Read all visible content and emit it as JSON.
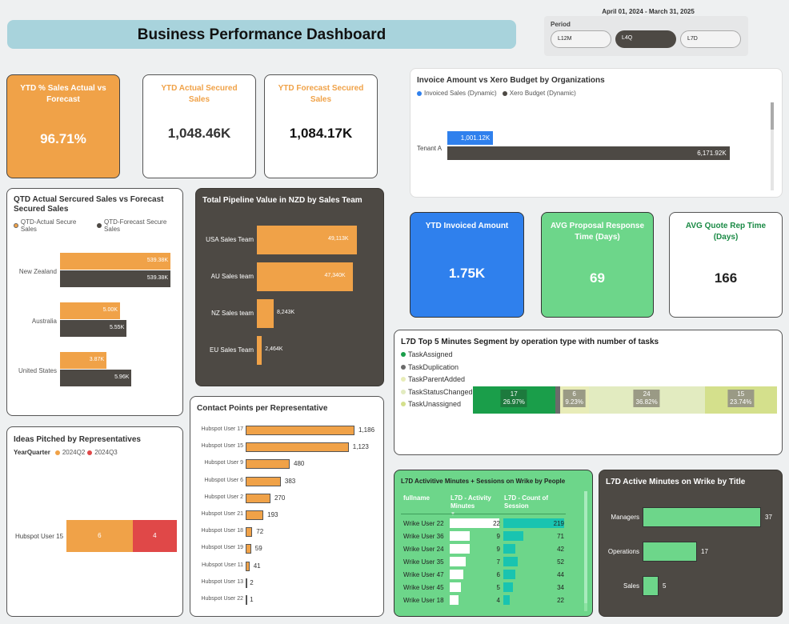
{
  "header": {
    "title": "Business Performance Dashboard",
    "date_range": "April 01, 2024 - March 31, 2025",
    "period_label": "Period",
    "period_options": [
      "L12M",
      "L4Q",
      "L7D"
    ],
    "selected_period": "L4Q"
  },
  "kpis": {
    "ytd_pct": {
      "title": "YTD % Sales Actual vs Forecast",
      "value": "96.71%"
    },
    "ytd_actual": {
      "title": "YTD Actual Secured Sales",
      "value": "1,048.46K"
    },
    "ytd_forecast": {
      "title": "YTD Forecast Secured Sales",
      "value": "1,084.17K"
    },
    "ytd_invoiced": {
      "title": "YTD Invoiced Amount",
      "value": "1.75K"
    },
    "avg_proposal": {
      "title": "AVG Proposal Response Time (Days)",
      "value": "69"
    },
    "avg_quote": {
      "title": "AVG Quote Rep Time (Days)",
      "value": "166"
    }
  },
  "colors": {
    "orange": "#f0a248",
    "dark": "#4d4944",
    "blue": "#2f80ed",
    "green": "#6dd68a",
    "red": "#e04848",
    "teal": "#19c4b0"
  },
  "chart_data": [
    {
      "id": "invoice",
      "type": "bar",
      "title": "Invoice Amount vs Xero Budget by Organizations",
      "categories": [
        "Tenant A"
      ],
      "series": [
        {
          "name": "Invoiced Sales (Dynamic)",
          "values": [
            1001.12
          ],
          "labels": [
            "1,001.12K"
          ]
        },
        {
          "name": "Xero Budget (Dynamic)",
          "values": [
            6171.92
          ],
          "labels": [
            "6,171.92K"
          ]
        }
      ]
    },
    {
      "id": "qtd",
      "type": "bar",
      "title": "QTD Actual Sercured Sales vs Forecast Secured Sales",
      "categories": [
        "New Zealand",
        "Australia",
        "United States"
      ],
      "series": [
        {
          "name": "QTD-Actual Secure Sales",
          "values": [
            539.38,
            5.0,
            3.87
          ],
          "labels": [
            "539.38K",
            "5.00K",
            "3.87K"
          ]
        },
        {
          "name": "QTD-Forecast Secure Sales",
          "values": [
            539.38,
            5.55,
            5.96
          ],
          "labels": [
            "539.38K",
            "5.55K",
            "5.96K"
          ]
        }
      ]
    },
    {
      "id": "pipeline",
      "type": "bar",
      "title": "Total Pipeline Value in NZD by Sales Team",
      "categories": [
        "USA Sales Team",
        "AU Sales team",
        "NZ Sales team",
        "EU Sales Team"
      ],
      "values": [
        49113,
        47340,
        8243,
        2464
      ],
      "labels": [
        "49,113K",
        "47,340K",
        "8,243K",
        "2,464K"
      ]
    },
    {
      "id": "contact",
      "type": "bar",
      "title": "Contact Points per Representative",
      "categories": [
        "Hubspot User 17",
        "Hubspot User 15",
        "Hubspot User 9",
        "Hubspot User 6",
        "Hubspot User 2",
        "Hubspot User 21",
        "Hubspot User 18",
        "Hubspot User 19",
        "Hubspot User 11",
        "Hubspot User 13",
        "Hubspot User 22"
      ],
      "values": [
        1186,
        1123,
        480,
        383,
        270,
        193,
        72,
        59,
        41,
        2,
        1
      ],
      "labels": [
        "1,186",
        "1,123",
        "480",
        "383",
        "270",
        "193",
        "72",
        "59",
        "41",
        "2",
        "1"
      ]
    },
    {
      "id": "ideas",
      "type": "bar",
      "title": "Ideas Pitched by Representatives",
      "legend_title": "YearQuarter",
      "categories": [
        "Hubspot User 15"
      ],
      "series": [
        {
          "name": "2024Q2",
          "values": [
            6
          ]
        },
        {
          "name": "2024Q3",
          "values": [
            4
          ]
        }
      ]
    },
    {
      "id": "segment",
      "type": "bar",
      "title": "L7D Top 5 Minutes Segment by operation type with number of tasks",
      "categories": [
        "TaskAssigned",
        "TaskDuplication",
        "TaskParentAdded",
        "TaskStatusChanged",
        "TaskUnassigned"
      ],
      "colors": [
        "#1a9e4a",
        "#6b6b6b",
        "#e8ecb8",
        "#e2ebc0",
        "#d4e08c"
      ],
      "values": [
        17,
        1,
        6,
        24,
        15
      ],
      "percents": [
        "26.97%",
        "",
        "9.23%",
        "36.82%",
        "23.74%"
      ]
    },
    {
      "id": "wrike_table",
      "type": "table",
      "title": "L7D Activitive Minutes + Sessions on Wrike by People",
      "columns": [
        "fullname",
        "L7D - Activity Minutes",
        "L7D - Count of Session"
      ],
      "rows": [
        [
          "Wrike User 22",
          22,
          219
        ],
        [
          "Wrike User 36",
          9,
          71
        ],
        [
          "Wrike User 24",
          9,
          42
        ],
        [
          "Wrike User 35",
          7,
          52
        ],
        [
          "Wrike User 47",
          6,
          44
        ],
        [
          "Wrike User 45",
          5,
          34
        ],
        [
          "Wrike User 18",
          4,
          22
        ]
      ]
    },
    {
      "id": "title",
      "type": "bar",
      "title": "L7D Active Minutes on Wrike by Title",
      "categories": [
        "Managers",
        "Operations",
        "Sales"
      ],
      "values": [
        37,
        17,
        5
      ]
    }
  ]
}
